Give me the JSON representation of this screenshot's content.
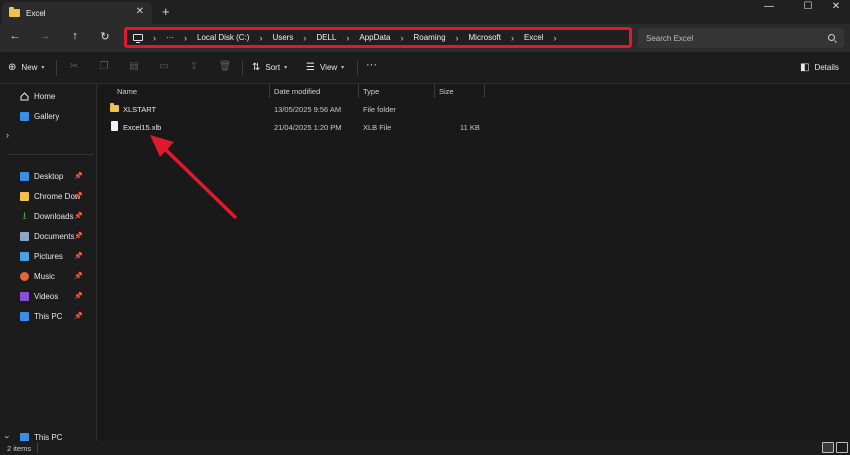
{
  "window": {
    "tab_title": "Excel",
    "tab_close": "✕",
    "new_tab": "+",
    "controls": {
      "minimize": "—",
      "maximize": "☐",
      "close": "✕"
    }
  },
  "nav": {
    "back": "←",
    "forward": "→",
    "up": "↑",
    "refresh": "↻",
    "more": "···",
    "sep": "›"
  },
  "breadcrumb": [
    "Local Disk (C:)",
    "Users",
    "DELL",
    "AppData",
    "Roaming",
    "Microsoft",
    "Excel"
  ],
  "search": {
    "placeholder": "Search Excel"
  },
  "toolbar": {
    "new_label": "New",
    "sort_label": "Sort",
    "view_label": "View",
    "more_label": "···",
    "details_label": "Details"
  },
  "sidebar": {
    "top": [
      {
        "label": "Home",
        "color": "#e8e8e8"
      },
      {
        "label": "Gallery",
        "color": "#3a8ee6"
      }
    ],
    "expand": "›",
    "quick": [
      {
        "label": "Desktop",
        "color": "#3a8ee6"
      },
      {
        "label": "Chrome Dow",
        "color": "#f0c24b"
      },
      {
        "label": "Downloads",
        "color": "#37b24d"
      },
      {
        "label": "Documents",
        "color": "#8aa7c4"
      },
      {
        "label": "Pictures",
        "color": "#4aa3e8"
      },
      {
        "label": "Music",
        "color": "#e8643a"
      },
      {
        "label": "Videos",
        "color": "#8a4fd6"
      },
      {
        "label": "This PC",
        "color": "#3a8ee6"
      }
    ],
    "pin": "📌",
    "bottom": {
      "label": "This PC",
      "color": "#3a8ee6"
    }
  },
  "columns": {
    "name": "Name",
    "date": "Date modified",
    "type": "Type",
    "size": "Size"
  },
  "files": [
    {
      "name": "XLSTART",
      "date": "13/05/2025 9:56 AM",
      "type": "File folder",
      "size": "",
      "kind": "folder"
    },
    {
      "name": "Excel15.xlb",
      "date": "21/04/2025 1:20 PM",
      "type": "XLB File",
      "size": "11 KB",
      "kind": "file"
    }
  ],
  "status": {
    "items": "2 items"
  },
  "colors": {
    "highlight": "#e0192d",
    "folder": "#f0c24b",
    "arrow": "#e0192d"
  }
}
